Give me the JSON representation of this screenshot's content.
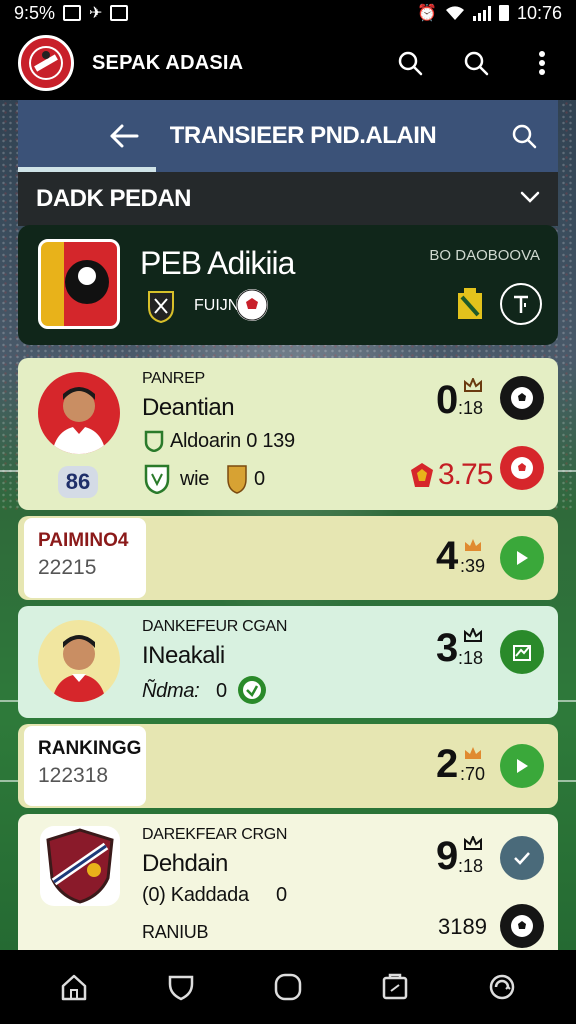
{
  "status_bar": {
    "left_text": "9:5%",
    "time": "10:76"
  },
  "app_bar": {
    "title": "SEPAK ADASIA"
  },
  "subheader": {
    "title": "TRANSIEER PND.ALAIN"
  },
  "section": {
    "title": "DADK PEDAN"
  },
  "team_card": {
    "name": "PEB Adikiia",
    "tag": "BO DAOBOOVA",
    "sub_label": "FUIJN"
  },
  "players": [
    {
      "role": "PANREP",
      "name": "Deantian",
      "meta": "Aldoarin 0 139",
      "badge_num": "86",
      "club": "wie",
      "club_extra": "0",
      "score_top": "0",
      "score_top_small": ":18",
      "score_bottom": "3.75"
    },
    {
      "role": "DANKEFEUR CGAN",
      "name": "INeakali",
      "meta": "Ñdma:",
      "meta_extra": "0",
      "score_top": "3",
      "score_top_small": ":18"
    },
    {
      "role": "DAREKFEAR CRGN",
      "name": "Dehdain",
      "meta": "(0) Kaddada",
      "meta_extra": "0",
      "extra_label": "RANIUB",
      "score_top": "9",
      "score_top_small": ":18",
      "score_bottom": "3189"
    }
  ],
  "rankings": [
    {
      "label": "PAIMINO4",
      "number": "22215",
      "score": "4",
      "score_small": ":39"
    },
    {
      "label": "RANKINGG",
      "number": "122318",
      "score": "2",
      "score_small": ":70"
    }
  ],
  "colors": {
    "app_bar": "#000000",
    "subheader": "#3b5278",
    "team_card": "#10261a",
    "player_card_yellow": "#e4eec4",
    "player_card_mint": "#d8f1e0",
    "ranking_card": "#e6e6b2",
    "accent_green": "#3aa83a",
    "accent_red": "#d6262b"
  }
}
